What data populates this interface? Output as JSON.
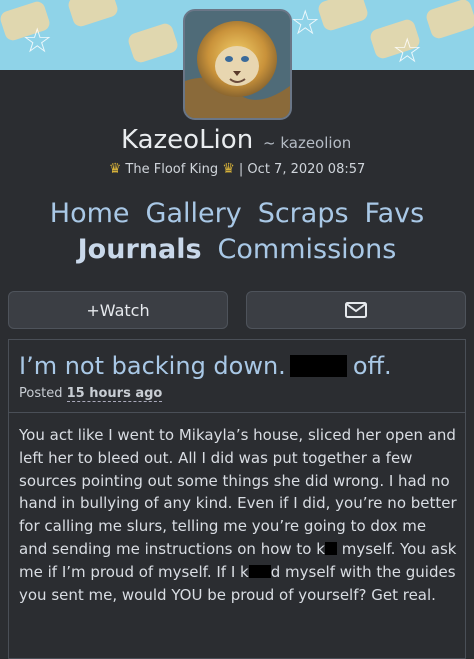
{
  "profile": {
    "username": "KazeoLion",
    "handle": "~ kazeolion",
    "user_title": "The Floof King",
    "date": "| Oct 7, 2020 08:57",
    "crown_left": "♛",
    "crown_right": "♛"
  },
  "nav": {
    "row1": [
      "Home",
      "Gallery",
      "Scraps",
      "Favs"
    ],
    "row2_active": "Journals",
    "row2_other": "Commissions"
  },
  "buttons": {
    "watch_label": "+Watch",
    "message_icon": "envelope-icon"
  },
  "journal": {
    "title_start": "I’m not backing down.",
    "title_end": "off.",
    "posted_prefix": "Posted",
    "posted_time": "15 hours ago",
    "body": {
      "p1": "You act like I went to Mikayla’s house, sliced her open and left her to bleed out. All I did was put together a few sources pointing out some things she did wrong. I had no hand in bullying of any kind. Even if I did, you’re no better for calling me slurs, telling me you’re going to dox me and sending me instructions on how to k",
      "p2": " myself. You ask me if I’m proud of myself. If I k",
      "p3": "d myself with the guides you sent me, would YOU be proud of yourself? Get real."
    }
  },
  "colors": {
    "background": "#2b2d31",
    "link": "#a9c8e6",
    "banner": "#8fd3e8"
  }
}
